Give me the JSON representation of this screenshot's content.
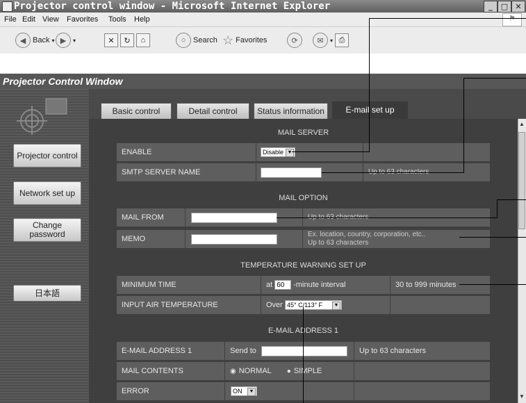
{
  "window": {
    "title": "Projector control window - Microsoft Internet Explorer"
  },
  "menu": [
    "File",
    "Edit",
    "View",
    "Favorites",
    "Tools",
    "Help"
  ],
  "toolbar": {
    "back": "Back",
    "search": "Search",
    "favorites": "Favorites"
  },
  "app": {
    "title": "Projector Control Window"
  },
  "sidebar": {
    "items": [
      "Projector control",
      "Network set up",
      "Change password",
      "日本語"
    ]
  },
  "tabs": [
    "Basic control",
    "Detail control",
    "Status information",
    "E-mail set up"
  ],
  "sections": {
    "mail_server": "MAIL SERVER",
    "mail_option": "MAIL OPTION",
    "temp_warning": "TEMPERATURE WARNING SET UP",
    "email_address": "E-MAIL ADDRESS 1"
  },
  "rows": {
    "enable": {
      "label": "ENABLE",
      "value": "Disable"
    },
    "smtp": {
      "label": "SMTP SERVER NAME",
      "hint": "Up to 63 characters"
    },
    "mail_from": {
      "label": "MAIL FROM",
      "hint": "Up to 63 characters"
    },
    "memo": {
      "label": "MEMO",
      "hint1": "Ex. location, country, corporation, etc..",
      "hint2": "Up to 63 characters"
    },
    "min_time": {
      "label": "MINIMUM TIME",
      "prefix": "at",
      "value": "60",
      "suffix": "-minute interval",
      "hint": "30 to 999 minutes"
    },
    "air_temp": {
      "label": "INPUT AIR TEMPERATURE",
      "prefix": "Over",
      "value": "45° C/113° F"
    },
    "email1": {
      "label": "E-MAIL ADDRESS 1",
      "prefix": "Send to",
      "hint": "Up to 63 characters"
    },
    "contents": {
      "label": "MAIL CONTENTS",
      "opt1": "NORMAL",
      "opt2": "SIMPLE"
    },
    "error": {
      "label": "ERROR",
      "value": "ON"
    }
  },
  "colors": {
    "panel": "#3f3f3f",
    "cell": "#5e5e5e",
    "titlebar": "#6f6f6f"
  }
}
